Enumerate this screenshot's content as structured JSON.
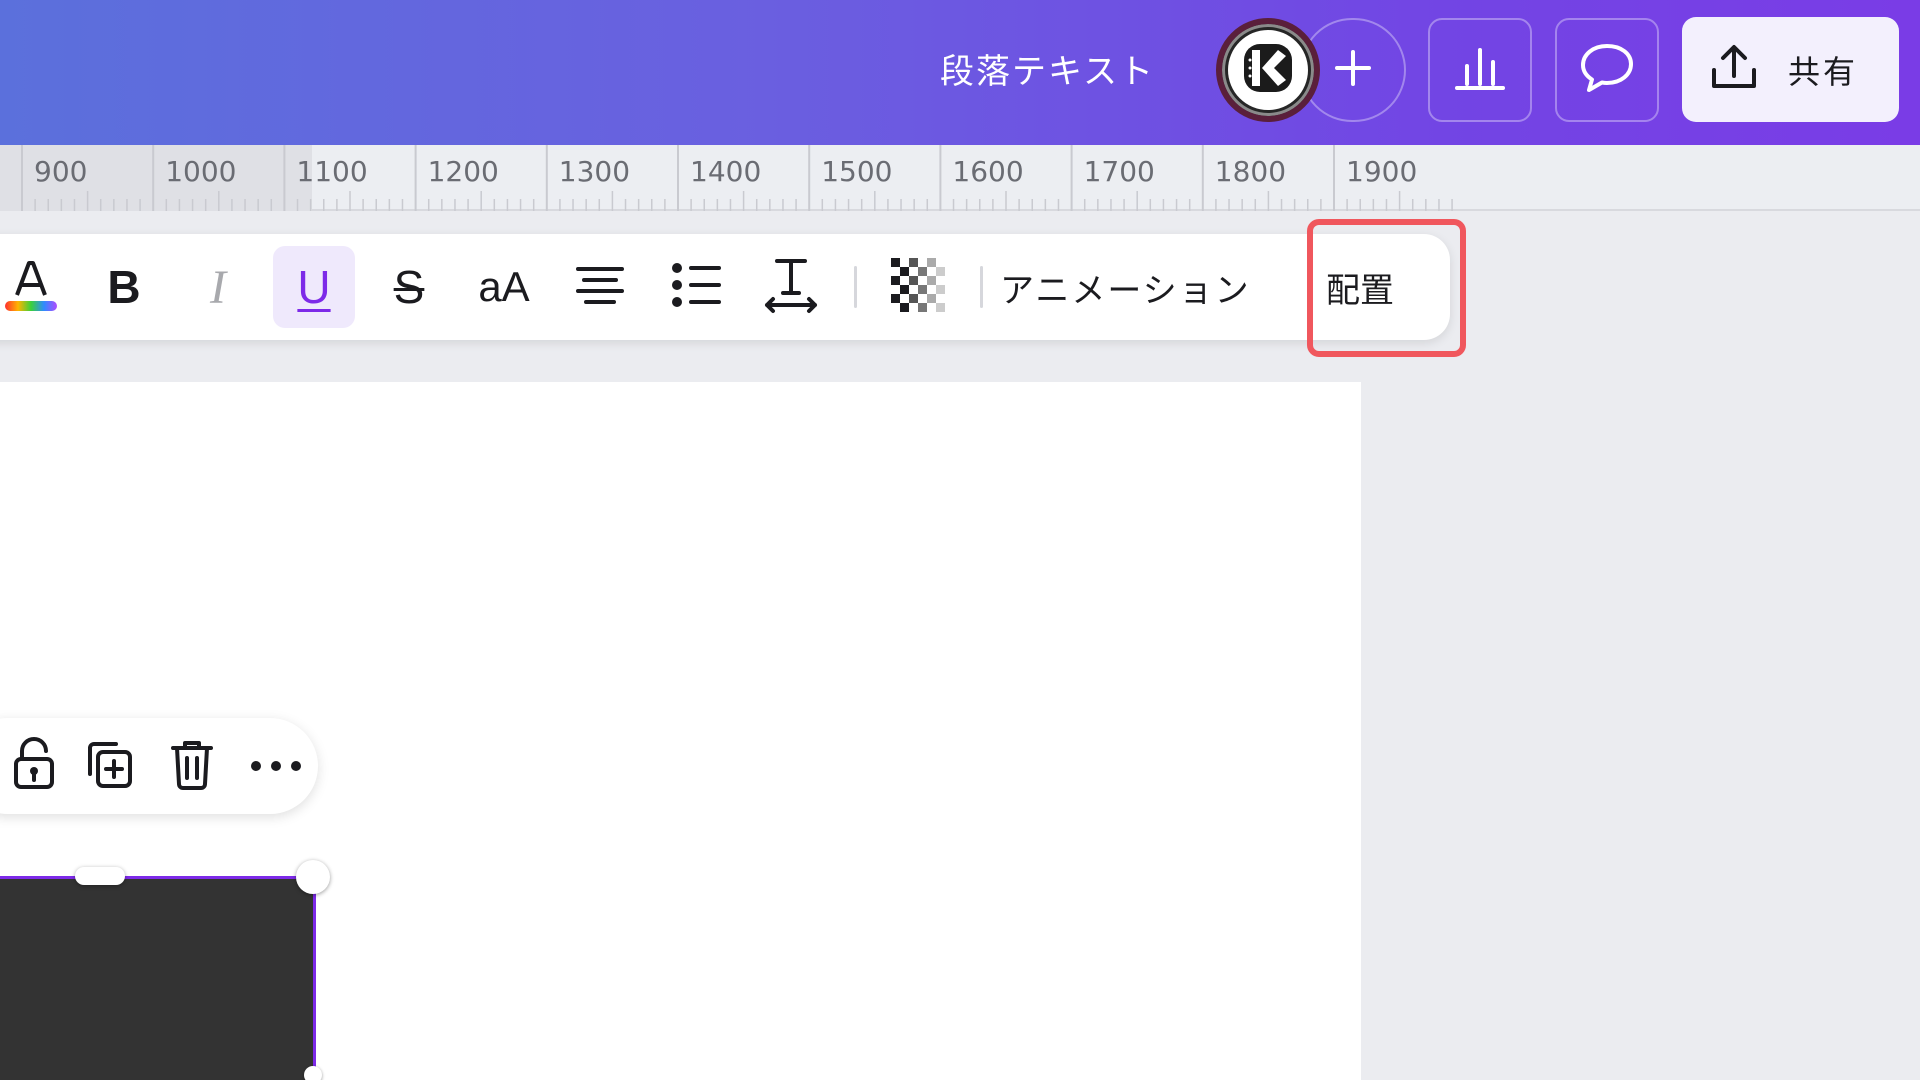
{
  "header": {
    "doc_title": "段落テキスト",
    "avatar_icon": "kanva-k-logo-icon",
    "add_icon": "plus-icon",
    "insights_icon": "bar-chart-icon",
    "comment_icon": "speech-bubble-icon",
    "share_icon": "upload-icon",
    "share_label": "共有"
  },
  "ruler": {
    "labels": [
      "900",
      "1000",
      "1100",
      "1200",
      "1300",
      "1400",
      "1500",
      "1600",
      "1700",
      "1800",
      "1900"
    ]
  },
  "toolbar": {
    "items": [
      {
        "icon": "text-color-icon"
      },
      {
        "icon": "bold-icon",
        "label": "B"
      },
      {
        "icon": "italic-icon",
        "label": "I"
      },
      {
        "icon": "underline-icon",
        "label": "U",
        "active": true
      },
      {
        "icon": "strikethrough-icon",
        "label": "S"
      },
      {
        "icon": "letter-case-icon",
        "label": "aA"
      },
      {
        "icon": "align-center-icon"
      },
      {
        "icon": "bullet-list-icon"
      },
      {
        "icon": "text-spacing-icon",
        "label": "T"
      },
      {
        "icon": "transparency-icon"
      }
    ],
    "animation_label": "アニメーション",
    "position_label": "配置"
  },
  "element_toolbar": {
    "items": [
      {
        "icon": "unlock-icon"
      },
      {
        "icon": "duplicate-icon"
      },
      {
        "icon": "trash-icon"
      },
      {
        "icon": "more-icon"
      }
    ]
  },
  "colors": {
    "accent": "#7d2ae8",
    "highlight": "#f0575d",
    "element_fill": "#333333"
  }
}
